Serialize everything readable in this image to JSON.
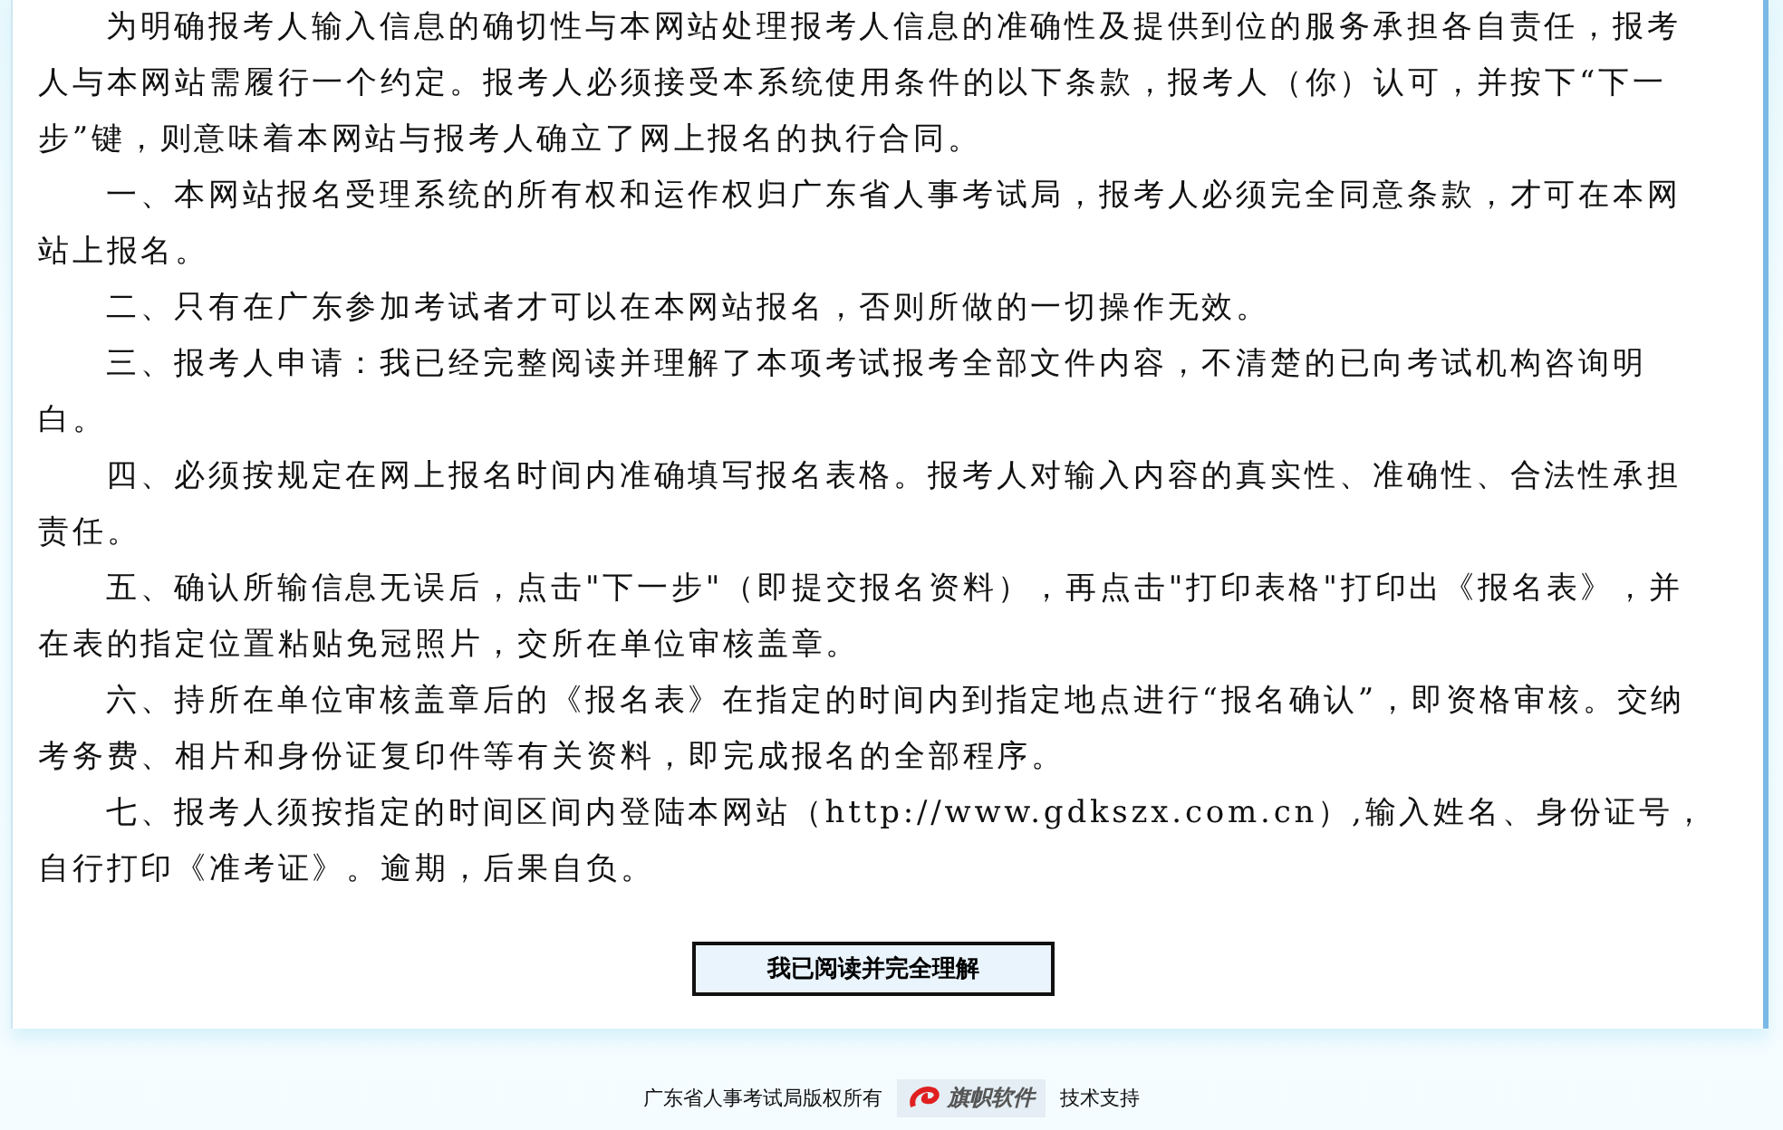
{
  "agreement": {
    "paragraphs": [
      "为明确报考人输入信息的确切性与本网站处理报考人信息的准确性及提供到位的服务承担各自责任，报考人与本网站需履行一个约定。报考人必须接受本系统使用条件的以下条款，报考人（你）认可，并按下“下一步”键，则意味着本网站与报考人确立了网上报名的执行合同。",
      " 一、本网站报名受理系统的所有权和运作权归广东省人事考试局，报考人必须完全同意条款，才可在本网站上报名。",
      "二、只有在广东参加考试者才可以在本网站报名，否则所做的一切操作无效。",
      "三、报考人申请：我已经完整阅读并理解了本项考试报考全部文件内容，不清楚的已向考试机构咨询明白。",
      "四、必须按规定在网上报名时间内准确填写报名表格。报考人对输入内容的真实性、准确性、合法性承担责任。",
      "五、确认所输信息无误后，点击\"下一步\"（即提交报名资料），再点击\"打印表格\"打印出《报名表》，并在表的指定位置粘贴免冠照片，交所在单位审核盖章。",
      "六、持所在单位审核盖章后的《报名表》在指定的时间内到指定地点进行“报名确认”，即资格审核。交纳考务费、相片和身份证复印件等有关资料，即完成报名的全部程序。",
      "七、报考人须按指定的时间区间内登陆本网站（http://www.gdkszx.com.cn）,输入姓名、身份证号，自行打印《准考证》。逾期，后果自负。"
    ]
  },
  "confirm_button": {
    "label": "我已阅读并完全理解"
  },
  "footer": {
    "copyright": "广东省人事考试局版权所有",
    "logo_text": "旗帜软件",
    "support": "技术支持"
  }
}
